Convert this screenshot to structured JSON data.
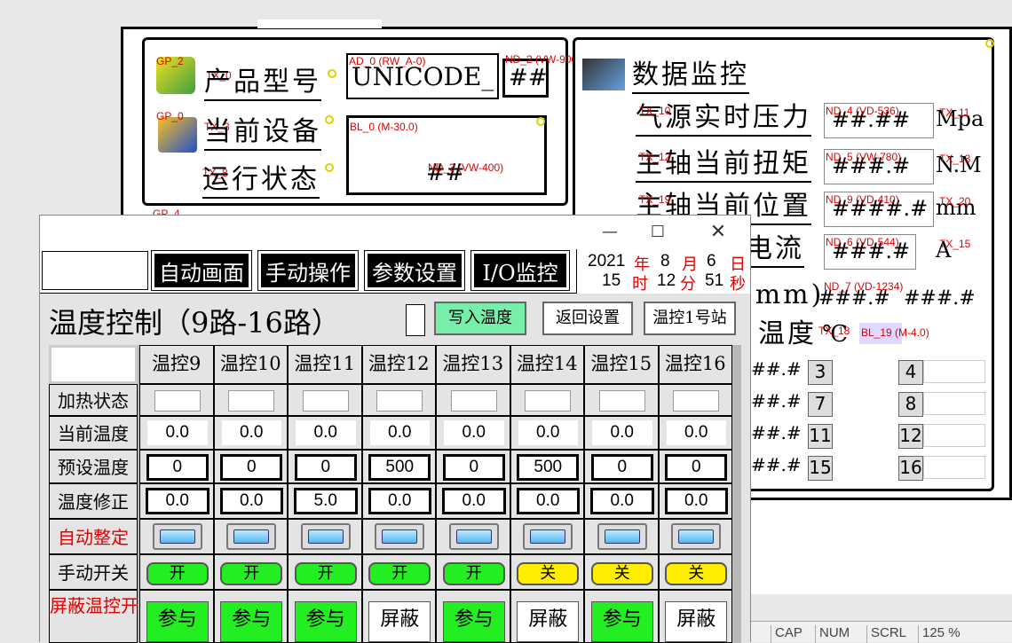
{
  "left_panel": {
    "model_label": "产品型号",
    "model_value": "UNICODE_",
    "model_hash": "##",
    "device_label": "当前设备",
    "status_label": "运行状态",
    "status_hash": "##",
    "tags": {
      "gp2": "GP_2",
      "tx0": "TX_0",
      "ad0": "AD_0 (RW_A-0)",
      "nd2": "ND_2 (VW-9000)",
      "gp0": "GP_0",
      "tx3": "TX_3",
      "bl": "BL_0 (M-30.0)",
      "tx8": "TX_8",
      "nd3": "ND_3 (VW-400)",
      "gp4": "GP_4"
    }
  },
  "right_panel": {
    "title": "数据监控",
    "rows": [
      {
        "label": "气源实时压力",
        "value": "##.##",
        "unit": "Mpa",
        "tag": "TX_10",
        "nd": "ND_4 (VD-536)",
        "tx2": "TX_11"
      },
      {
        "label": "主轴当前扭矩",
        "value": "###.#",
        "unit": "N.M",
        "tag": "TX_12",
        "nd": "ND_5 (VW-780)",
        "tx2": "TX_13"
      },
      {
        "label": "主轴当前位置",
        "value": "####.#",
        "unit": "mm",
        "tag": "TX_19",
        "nd": "ND_9 (VD-410)",
        "tx2": "TX_20"
      },
      {
        "label": "电流",
        "value": "###.#",
        "unit": "A",
        "tag": "",
        "nd": "ND_6 (VD-544)",
        "tx2": "TX_15"
      }
    ],
    "mm_label": "(mm)",
    "mm_hash1": "###.#",
    "mm_hash2": "###.#",
    "nd7": "ND_7 (VD-1234)",
    "temp_label": "温度",
    "temp_unit": "℃",
    "tx18": "TX_18",
    "bl19": "BL_19 (M-4.0)",
    "grid_rows": [
      {
        "hash": "##.#",
        "n1": "3",
        "n2": "4"
      },
      {
        "hash": "##.#",
        "n1": "7",
        "n2": "8"
      },
      {
        "hash": "##.#",
        "n1": "11",
        "n2": "12"
      },
      {
        "hash": "##.#",
        "n1": "15",
        "n2": "16"
      }
    ]
  },
  "window": {
    "nav": [
      "自动画面",
      "手动操作",
      "参数设置",
      "I/O监控"
    ],
    "clock": {
      "year": "2021",
      "month": "8",
      "day": "6",
      "hour": "15",
      "minute": "12",
      "second": "51",
      "y_lbl": "年",
      "m_lbl": "月",
      "d_lbl": "日",
      "h_lbl": "时",
      "mi_lbl": "分",
      "s_lbl": "秒"
    },
    "heading": "温度控制（9路-16路）",
    "write_btn": "写入温度",
    "back_btn": "返回设置",
    "station_btn": "温控1号站",
    "columns": [
      "温控9",
      "温控10",
      "温控11",
      "温控12",
      "温控13",
      "温控14",
      "温控15",
      "温控16"
    ],
    "row_labels": [
      "加热状态",
      "当前温度",
      "预设温度",
      "温度修正",
      "自动整定",
      "手动开关",
      "屏蔽温控开启加热"
    ],
    "current_temp": [
      "0.0",
      "0.0",
      "0.0",
      "0.0",
      "0.0",
      "0.0",
      "0.0",
      "0.0"
    ],
    "preset_temp": [
      "0",
      "0",
      "0",
      "500",
      "0",
      "500",
      "0",
      "0"
    ],
    "correction": [
      "0.0",
      "0.0",
      "5.0",
      "0.0",
      "0.0",
      "0.0",
      "0.0",
      "0.0"
    ],
    "switch": [
      "开",
      "开",
      "开",
      "开",
      "开",
      "关",
      "关",
      "关"
    ],
    "mask": [
      "参与",
      "参与",
      "参与",
      "屏蔽",
      "参与",
      "屏蔽",
      "参与",
      "屏蔽"
    ]
  },
  "statusbar": {
    "cap": "CAP",
    "num": "NUM",
    "scrl": "SCRL",
    "zoom": "125 %"
  },
  "colors": {
    "on": "#22ee22",
    "off": "#ffee00",
    "red": "#e00000",
    "write_bg": "#77eeaa"
  }
}
